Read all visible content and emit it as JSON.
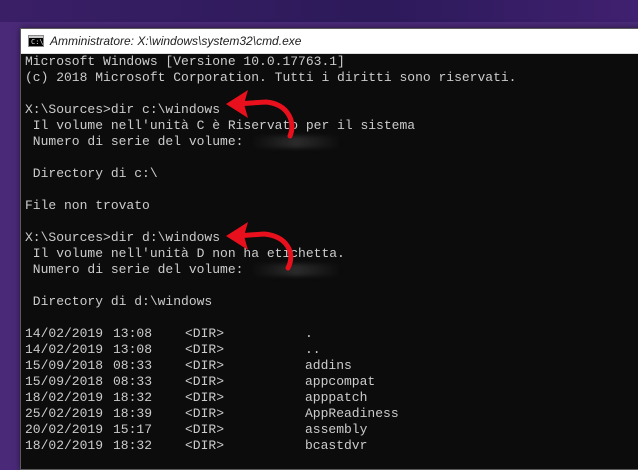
{
  "window": {
    "title": "Amministratore: X:\\windows\\system32\\cmd.exe",
    "icon_glyph": "C:\\"
  },
  "console": {
    "lines": [
      "Microsoft Windows [Versione 10.0.17763.1]",
      "(c) 2018 Microsoft Corporation. Tutti i diritti sono riservati.",
      "",
      "X:\\Sources>dir c:\\windows",
      " Il volume nell'unità C è Riservato per il sistema",
      " Numero di serie del volume: ",
      "",
      " Directory di c:\\",
      "",
      "File non trovato",
      "",
      "X:\\Sources>dir d:\\windows",
      " Il volume nell'unità D non ha etichetta.",
      " Numero di serie del volume: ",
      "",
      " Directory di d:\\windows",
      ""
    ],
    "listing": [
      {
        "date": "14/02/2019",
        "time": "13:08",
        "type": "<DIR>",
        "name": "."
      },
      {
        "date": "14/02/2019",
        "time": "13:08",
        "type": "<DIR>",
        "name": ".."
      },
      {
        "date": "15/09/2018",
        "time": "08:33",
        "type": "<DIR>",
        "name": "addins"
      },
      {
        "date": "15/09/2018",
        "time": "08:33",
        "type": "<DIR>",
        "name": "appcompat"
      },
      {
        "date": "18/02/2019",
        "time": "18:32",
        "type": "<DIR>",
        "name": "apppatch"
      },
      {
        "date": "25/02/2019",
        "time": "18:39",
        "type": "<DIR>",
        "name": "AppReadiness"
      },
      {
        "date": "20/02/2019",
        "time": "15:17",
        "type": "<DIR>",
        "name": "assembly"
      },
      {
        "date": "18/02/2019",
        "time": "18:32",
        "type": "<DIR>",
        "name": "bcastdvr"
      }
    ]
  },
  "colors": {
    "console_bg": "#0c0c0c",
    "console_text": "#cccccc",
    "annotation_arrow": "#e8101c"
  },
  "icons": [
    "cmd-icon",
    "red-arrow-icon"
  ]
}
